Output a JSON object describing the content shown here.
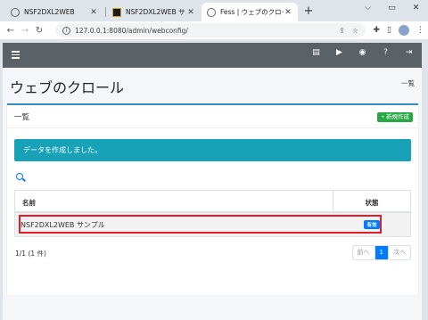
{
  "browser": {
    "tabs": [
      {
        "title": "NSF2DXL2WEB",
        "active": false
      },
      {
        "title": "NSF2DXL2WEB サンプル",
        "active": false
      },
      {
        "title": "Fess | ウェブのクロール",
        "active": true
      }
    ],
    "new_tab": "+",
    "url": "127.0.0.1:8080/admin/webconfig/",
    "window_controls": {
      "minimize": "⌵",
      "restore": "▭",
      "close": "✕"
    }
  },
  "app": {
    "page_title": "ウェブのクロール",
    "breadcrumb": "一覧",
    "card": {
      "title": "一覧",
      "new_button": "+ 新規作成",
      "alert": "データを作成しました。",
      "table": {
        "columns": [
          "名前",
          "状態"
        ],
        "rows": [
          {
            "name": "NSF2DXL2WEB サンプル",
            "status": "有効"
          }
        ]
      },
      "count": "1/1 (1 件)",
      "pagination": {
        "prev": "前へ",
        "current": "1",
        "next": "次へ"
      }
    }
  },
  "colors": {
    "navbar": "#5a6167",
    "alert": "#17a2b8",
    "new_button": "#28a745",
    "badge": "#007bff",
    "highlight": "#e01e2a"
  }
}
